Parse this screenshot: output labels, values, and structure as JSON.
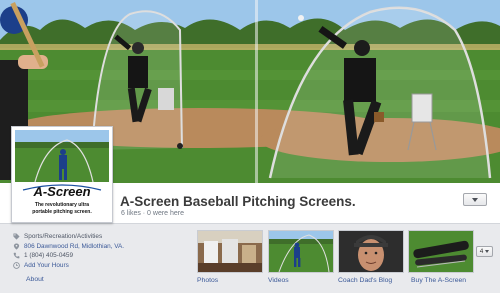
{
  "page": {
    "title": "A-Screen Baseball Pitching Screens.",
    "likes_line": "6 likes · 0 were here"
  },
  "profile": {
    "logo_text": "A-Screen",
    "tagline_line1": "The revolutionary ultra",
    "tagline_line2": "portable pitching screen."
  },
  "info": {
    "category": "Sports/Recreation/Activities",
    "address": "806 Dawnwood Rd, Midlothian, VA.",
    "phone": "1 (804) 405-0459",
    "add_hours": "Add Your Hours",
    "about": "About"
  },
  "tabs": [
    {
      "label": "Photos"
    },
    {
      "label": "Videos"
    },
    {
      "label": "Coach Dad's Blog"
    },
    {
      "label": "Buy The A-Screen"
    }
  ],
  "more_tabs_count": "4",
  "colors": {
    "link": "#3b5998",
    "strip_bg": "#e9eaed"
  },
  "icons": {
    "category": "tag-icon",
    "address": "location-pin-icon",
    "phone": "phone-icon",
    "hours": "clock-icon"
  }
}
